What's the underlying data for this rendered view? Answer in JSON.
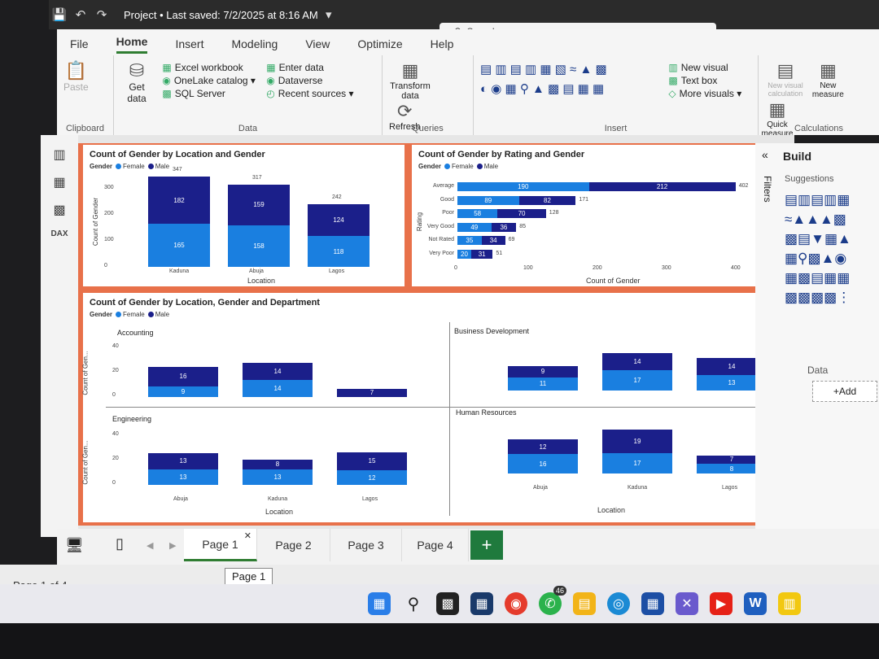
{
  "window": {
    "title": "Project • Last saved: 7/2/2025 at 8:16 AM",
    "search_placeholder": "Search"
  },
  "menu": [
    "File",
    "Home",
    "Insert",
    "Modeling",
    "View",
    "Optimize",
    "Help"
  ],
  "ribbon": {
    "clipboard": {
      "paste": "Paste",
      "label": "Clipboard"
    },
    "data": {
      "get_data": "Get data",
      "excel": "Excel workbook",
      "onelake": "OneLake catalog",
      "sql": "SQL Server",
      "enter": "Enter data",
      "dataverse": "Dataverse",
      "recent": "Recent sources",
      "label": "Data"
    },
    "queries": {
      "transform": "Transform data",
      "refresh": "Refresh",
      "label": "Queries"
    },
    "insert": {
      "new_visual": "New visual",
      "text_box": "Text box",
      "more_visuals": "More visuals",
      "label": "Insert"
    },
    "calculations": {
      "new_visual_calc": "New visual calculation",
      "new_measure": "New measure",
      "quick": "Quick measure",
      "label": "Calculations"
    }
  },
  "panes": {
    "build": "Build",
    "suggestions": "Suggestions",
    "filters": "Filters",
    "data": "Data",
    "add": "+Add"
  },
  "tabs": [
    "Page 1",
    "Page 2",
    "Page 3",
    "Page 4"
  ],
  "tooltip": "Page 1",
  "status": "Page 1 of 4",
  "taskbar_badge": "46",
  "colors": {
    "female": "#1a7fe0",
    "male": "#1b1f8a",
    "accent": "#e8714a",
    "ribbon_green": "#2f7d32"
  },
  "chart_data": [
    {
      "type": "bar",
      "title": "Count of Gender by Location and Gender",
      "legend_title": "Gender",
      "xlabel": "Location",
      "ylabel": "Count of Gender",
      "categories": [
        "Kaduna",
        "Abuja",
        "Lagos"
      ],
      "series": [
        {
          "name": "Female",
          "values": [
            165,
            158,
            118
          ]
        },
        {
          "name": "Male",
          "values": [
            182,
            159,
            124
          ]
        }
      ],
      "totals": [
        347,
        317,
        242
      ],
      "yticks": [
        "0",
        "100",
        "200",
        "300"
      ],
      "ylim": [
        0,
        350
      ]
    },
    {
      "type": "bar",
      "title": "Count of Gender by Rating and Gender",
      "legend_title": "Gender",
      "xlabel": "Count of Gender",
      "ylabel": "Rating",
      "categories": [
        "Average",
        "Good",
        "Poor",
        "Very Good",
        "Not Rated",
        "Very Poor"
      ],
      "series": [
        {
          "name": "Female",
          "values": [
            190,
            89,
            58,
            49,
            35,
            20
          ]
        },
        {
          "name": "Male",
          "values": [
            212,
            82,
            70,
            36,
            34,
            31
          ]
        }
      ],
      "totals": [
        402,
        171,
        128,
        85,
        69,
        51
      ],
      "xticks": [
        "0",
        "100",
        "200",
        "300",
        "400"
      ],
      "xlim": [
        0,
        400
      ]
    },
    {
      "type": "bar",
      "title": "Count of Gender by Location, Gender and Department",
      "legend_title": "Gender",
      "xlabel": "Location",
      "ylabel": "Count of Gen...",
      "categories": [
        "Abuja",
        "Kaduna",
        "Lagos"
      ],
      "yticks": [
        "0",
        "20",
        "40"
      ],
      "ylim": [
        0,
        40
      ],
      "panels": [
        {
          "name": "Accounting",
          "series": [
            {
              "name": "Female",
              "values": [
                9,
                14,
                0
              ]
            },
            {
              "name": "Male",
              "values": [
                16,
                14,
                7
              ]
            }
          ]
        },
        {
          "name": "Business Development",
          "series": [
            {
              "name": "Female",
              "values": [
                11,
                17,
                13
              ]
            },
            {
              "name": "Male",
              "values": [
                9,
                14,
                14
              ]
            }
          ]
        },
        {
          "name": "Engineering",
          "series": [
            {
              "name": "Female",
              "values": [
                13,
                13,
                12
              ]
            },
            {
              "name": "Male",
              "values": [
                13,
                8,
                15
              ]
            }
          ]
        },
        {
          "name": "Human Resources",
          "series": [
            {
              "name": "Female",
              "values": [
                16,
                17,
                8
              ]
            },
            {
              "name": "Male",
              "values": [
                12,
                19,
                7
              ]
            }
          ]
        }
      ]
    }
  ]
}
